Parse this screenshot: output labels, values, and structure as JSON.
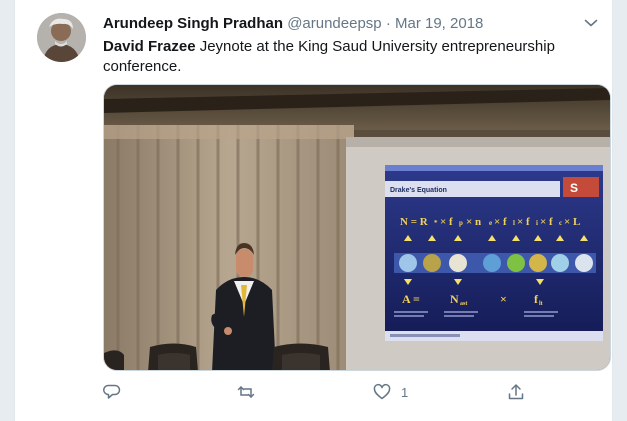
{
  "tweet": {
    "author_name": "Arundeep Singh Pradhan",
    "handle": "@arundeepsp",
    "separator": "·",
    "date": "Mar 19, 2018",
    "mention": "David Frazee",
    "body": " Jeynote at the King Saud University entrepreneurship conference."
  },
  "slide": {
    "title": "Drake's Equation",
    "equation_terms": [
      "N",
      "=",
      "R*",
      "×",
      "fp",
      "×",
      "ne",
      "×",
      "fl",
      "×",
      "fi",
      "×",
      "fc",
      "×",
      "L"
    ],
    "bottom_terms": [
      "A",
      "=",
      "Nast",
      "×",
      "flt"
    ]
  },
  "actions": {
    "reply_count": "",
    "retweet_count": "",
    "like_count": "1"
  },
  "icons": {
    "reply": "reply-icon",
    "retweet": "retweet-icon",
    "like": "heart-icon",
    "share": "share-icon",
    "menu": "chevron-down-icon"
  },
  "colors": {
    "text": "#14171a",
    "secondary": "#657786",
    "slide_background": "#1e2a78"
  }
}
